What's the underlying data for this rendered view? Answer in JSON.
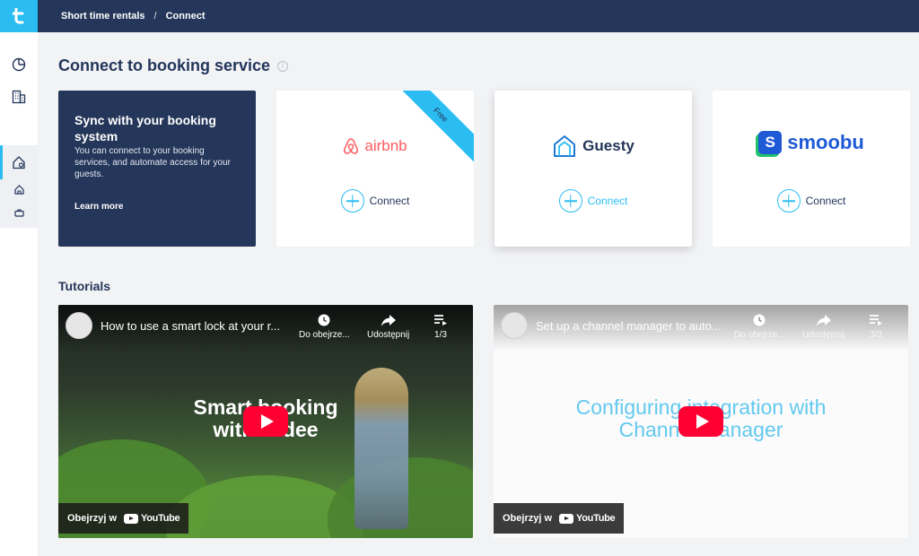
{
  "breadcrumb": {
    "root": "Short time rentals",
    "separator": "/",
    "current": "Connect"
  },
  "page": {
    "title": "Connect to booking service"
  },
  "sync_card": {
    "title": "Sync with your booking system",
    "description": "You can connect to your booking services, and automate access for your guests.",
    "learn_more": "Learn more"
  },
  "services": [
    {
      "name": "airbnb",
      "connect_label": "Connect",
      "badge": "Free",
      "brand_color": "#ff5a5f"
    },
    {
      "name": "Guesty",
      "connect_label": "Connect",
      "brand_color": "#1f7ad6"
    },
    {
      "name": "smoobu",
      "connect_label": "Connect",
      "brand_color": "#1f5ad6"
    }
  ],
  "tutorials": {
    "title": "Tutorials",
    "videos": [
      {
        "title": "How to use a smart lock at your r...",
        "actions": [
          "Do obejrze...",
          "Udostępnij",
          "1/3"
        ],
        "headline_1": "Smart booking",
        "headline_2": "with Tedee",
        "watch_on": "Obejrzyj w",
        "platform": "YouTube"
      },
      {
        "title": "Set up a channel manager to auto...",
        "actions": [
          "Do obejrze...",
          "Udostępnij",
          "3/3"
        ],
        "headline_1": "Configuring integration with",
        "headline_2": "Channel Manager",
        "watch_on": "Obejrzyj w",
        "platform": "YouTube"
      }
    ]
  },
  "colors": {
    "navy": "#243659",
    "accent": "#2bbdf2",
    "background": "#f2f3f5"
  }
}
